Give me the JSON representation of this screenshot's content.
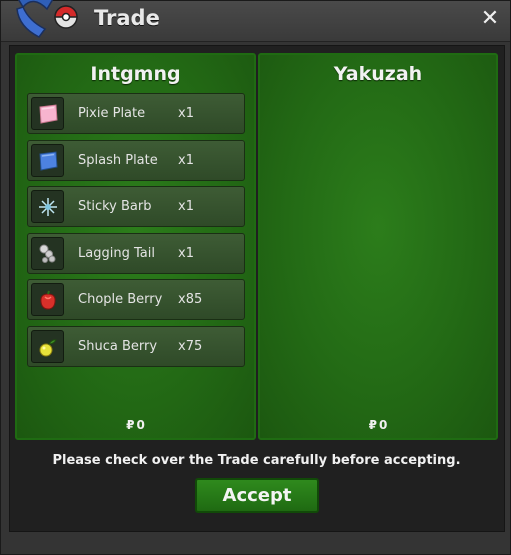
{
  "window": {
    "title": "Trade"
  },
  "left": {
    "name": "Intgmng",
    "money": "0",
    "items": [
      {
        "name": "Pixie Plate",
        "qty": "x1",
        "icon": "pixie-plate-icon"
      },
      {
        "name": "Splash Plate",
        "qty": "x1",
        "icon": "splash-plate-icon"
      },
      {
        "name": "Sticky Barb",
        "qty": "x1",
        "icon": "sticky-barb-icon"
      },
      {
        "name": "Lagging Tail",
        "qty": "x1",
        "icon": "lagging-tail-icon"
      },
      {
        "name": "Chople Berry",
        "qty": "x85",
        "icon": "chople-berry-icon"
      },
      {
        "name": "Shuca Berry",
        "qty": "x75",
        "icon": "shuca-berry-icon"
      }
    ]
  },
  "right": {
    "name": "Yakuzah",
    "money": "0"
  },
  "currency_symbol": "₽",
  "notice": "Please check over the Trade carefully before accepting.",
  "accept_label": "Accept",
  "colors": {
    "panel_green": "#236a15",
    "accept_green": "#2f8a1d"
  }
}
